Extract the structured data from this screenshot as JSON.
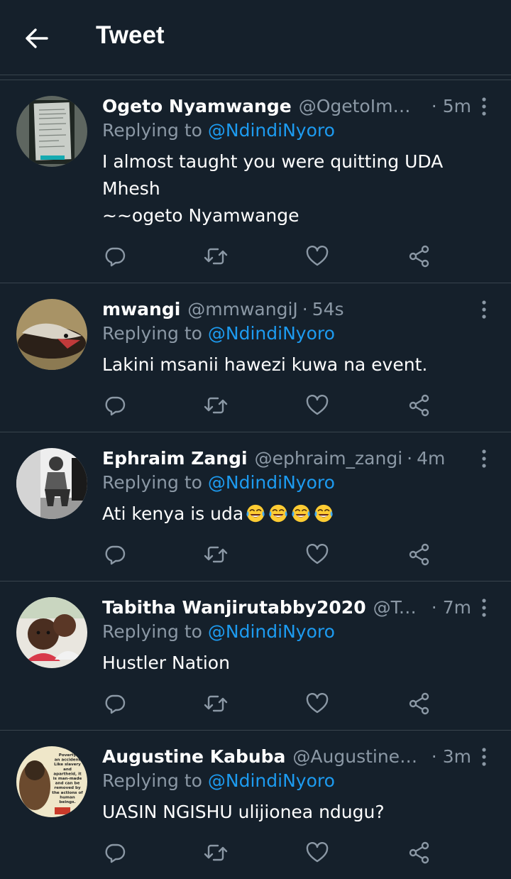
{
  "header": {
    "back_icon": "arrow-left-icon",
    "title": "Tweet"
  },
  "colors": {
    "background": "#15202b",
    "divider": "#38444d",
    "secondary_text": "#8b98a5",
    "accent": "#1d9bf0"
  },
  "replies": [
    {
      "name": "Ogeto Nyamwange",
      "handle": "@OgetoImma...",
      "time": "5m",
      "replying_prefix": "Replying to ",
      "replying_to": "@NdindiNyoro",
      "text": "I almost taught you were quitting UDA\nMhesh\n~~ogeto Nyamwange"
    },
    {
      "name": "mwangi",
      "handle": "@mmwangiJ",
      "time": "54s",
      "replying_prefix": "Replying to ",
      "replying_to": "@NdindiNyoro",
      "text": "Lakini msanii hawezi kuwa na event."
    },
    {
      "name": "Ephraim Zangi",
      "handle": "@ephraim_zangi",
      "time": "4m",
      "replying_prefix": "Replying to ",
      "replying_to": "@NdindiNyoro",
      "text": "Ati kenya is uda",
      "emoji": "face-with-tears-of-joy",
      "emoji_count": 4
    },
    {
      "name": "Tabitha Wanjirutabby2020",
      "handle": "@Tab...",
      "time": "7m",
      "replying_prefix": "Replying to ",
      "replying_to": "@NdindiNyoro",
      "text": "Hustler Nation"
    },
    {
      "name": "Augustine Kabuba",
      "handle": "@AugustineK...",
      "time": "3m",
      "replying_prefix": "Replying to ",
      "replying_to": "@NdindiNyoro",
      "text": "UASIN NGISHU ulijionea ndugu?"
    }
  ],
  "avatar_text": {
    "augustine": [
      "Poverty",
      "an accident",
      "Like slavery",
      "and",
      "apartheid, it",
      "is man-made",
      "and can be",
      "removed by",
      "the actions of",
      "human",
      "beings."
    ]
  },
  "action_icons": [
    "reply-icon",
    "retweet-icon",
    "like-icon",
    "share-icon"
  ]
}
